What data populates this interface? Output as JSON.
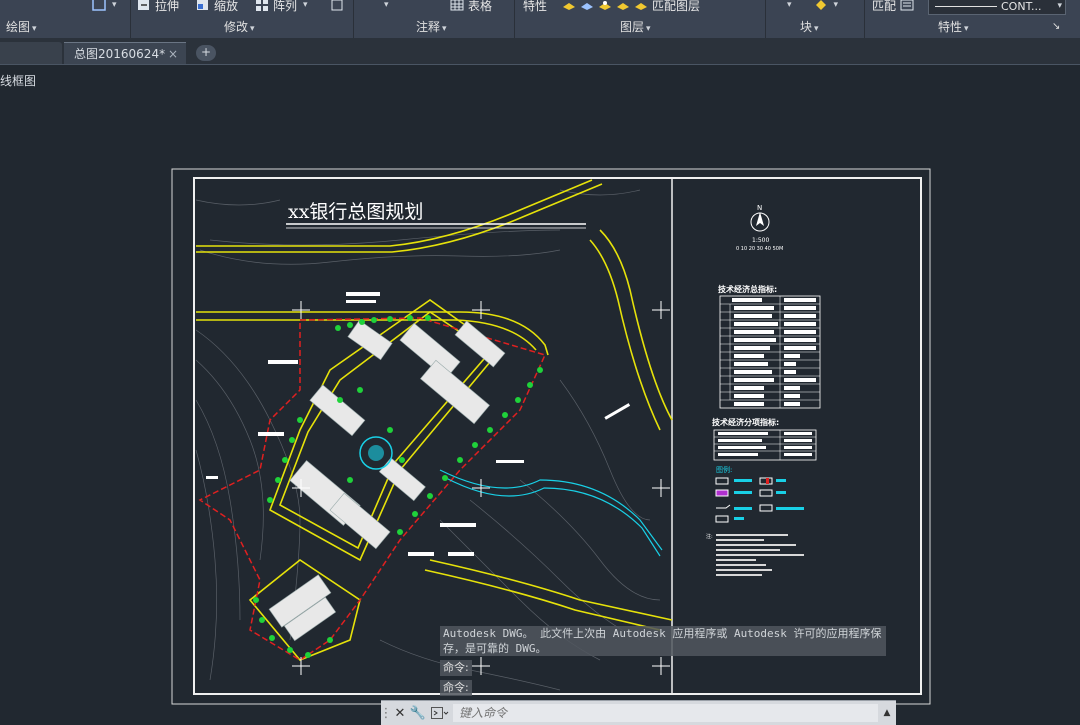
{
  "ribbon": {
    "top": {
      "stretch": "拉伸",
      "scale": "缩放",
      "array": "阵列",
      "table": "表格",
      "properties": "特性",
      "match_layer": "匹配图层",
      "match": "匹配",
      "linetype": "CONT..."
    },
    "panels": {
      "draw": "绘图",
      "modify": "修改",
      "annotation": "注释",
      "layers": "图层",
      "block": "块",
      "properties": "特性"
    }
  },
  "tabs": {
    "active": "总图20160624*",
    "close_glyph": "×",
    "new_glyph": "+"
  },
  "viewport": {
    "label": "线框图"
  },
  "drawing": {
    "title": "xx银行总图规划",
    "scale": "1:500",
    "scale_ticks": "0  10  20  30  40  50M",
    "tech_table_title": "技术经济总指标:",
    "tech_table2_title": "技术经济分项指标:",
    "legend_title": "图例:",
    "notes_title": "注:",
    "north_glyph": "N"
  },
  "command": {
    "message": "Autodesk DWG。  此文件上次由 Autodesk 应用程序或 Autodesk 许可的应用程序保存，是可靠的 DWG。",
    "prompt1": "命令:",
    "prompt2": "命令:",
    "placeholder": "键入命令"
  },
  "colors": {
    "background": "#212830",
    "ribbon": "#3b4453",
    "road": "#e6e20a",
    "boundary": "#e02020",
    "water": "#19d0e6",
    "tree": "#1fd23a"
  }
}
